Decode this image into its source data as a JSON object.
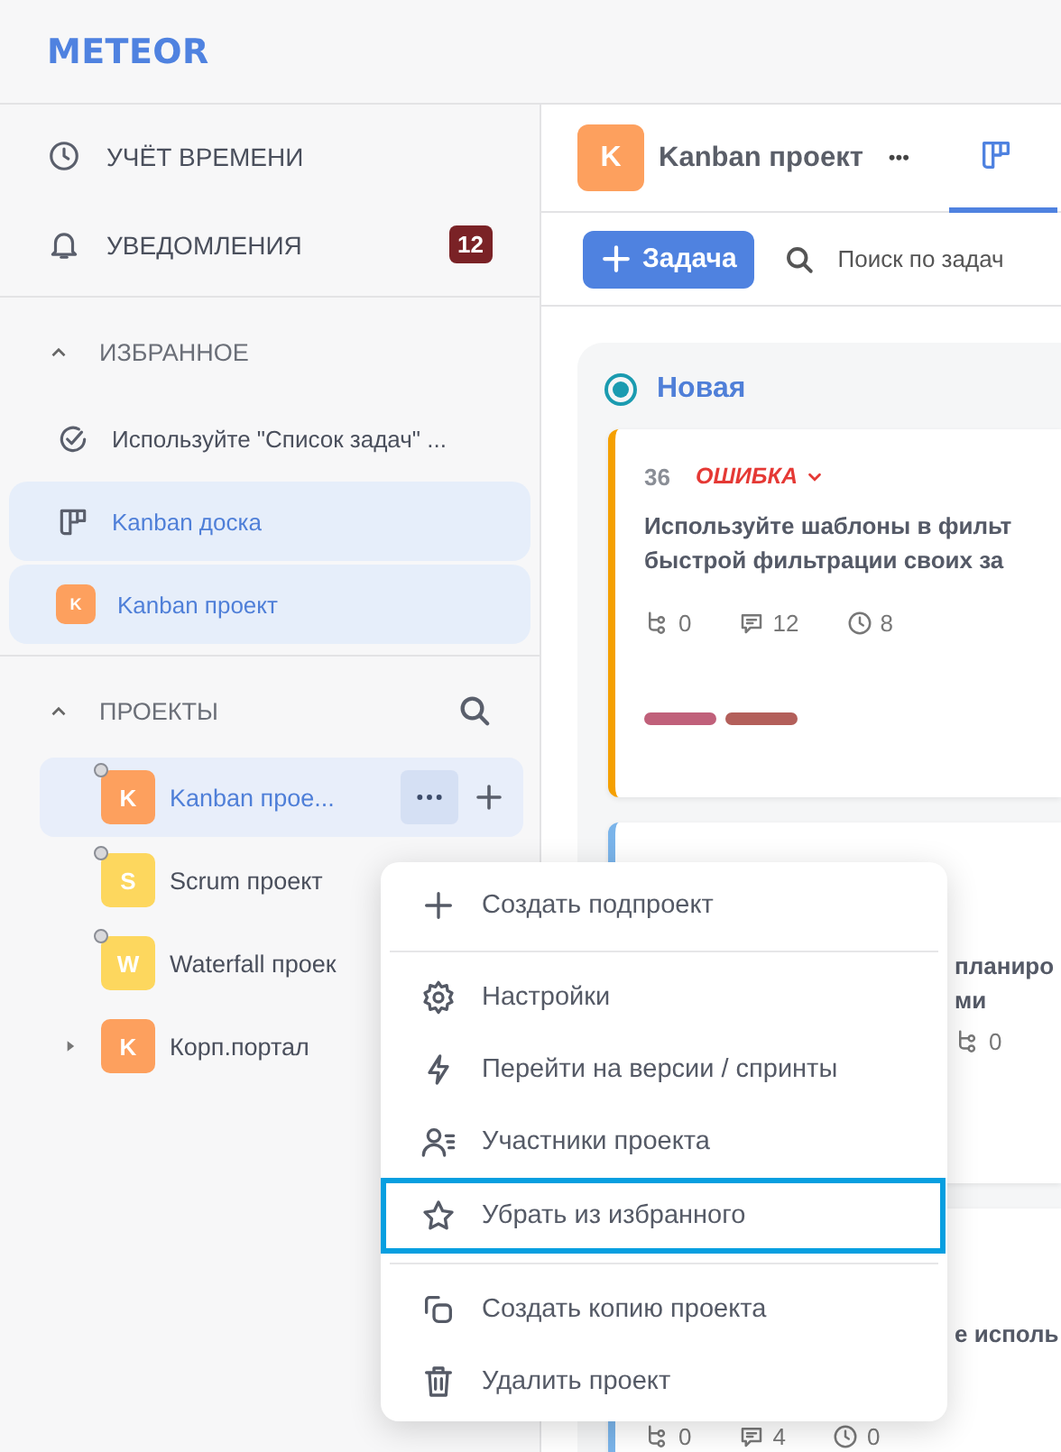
{
  "logo": "METEOR",
  "nav": [
    {
      "label": "УЧЁТ ВРЕМЕНИ"
    },
    {
      "label": "УВЕДОМЛЕНИЯ",
      "badge": "12"
    }
  ],
  "favorites": {
    "title": "ИЗБРАННОЕ",
    "expanded": true,
    "items": [
      {
        "kind": "task",
        "label": "Используйте \"Список задач\" ...",
        "selected": false
      },
      {
        "kind": "board",
        "label": "Kanban доска",
        "selected": true
      },
      {
        "kind": "project",
        "avatar": "K",
        "color": "#fda05e",
        "label": "Kanban проект",
        "selected": true
      }
    ]
  },
  "projects": {
    "title": "ПРОЕКТЫ",
    "expanded": true,
    "items": [
      {
        "avatar": "K",
        "color": "#fda05e",
        "label": "Kanban прое...",
        "selected": true,
        "dot": true,
        "expandable": false
      },
      {
        "avatar": "S",
        "color": "#fdd75e",
        "label": "Scrum проект",
        "selected": false,
        "dot": true,
        "expandable": false
      },
      {
        "avatar": "W",
        "color": "#fdd75e",
        "label": "Waterfall проек",
        "selected": false,
        "dot": true,
        "expandable": false
      },
      {
        "avatar": "K",
        "color": "#fda05e",
        "label": "Корп.портал",
        "selected": false,
        "dot": false,
        "expandable": true
      }
    ]
  },
  "header": {
    "avatar": "K",
    "color": "#fda05e",
    "title": "Kanban проект",
    "more": "•••"
  },
  "toolbar": {
    "button": "Задача",
    "search_placeholder": "Поиск по задач"
  },
  "column": {
    "title": "Новая",
    "cards": [
      {
        "number": "36",
        "type": "ОШИБКА",
        "color": "#f5a000",
        "title_lines": [
          "Используйте шаблоны в фильт",
          "быстрой фильтрации своих за"
        ],
        "stats": [
          "0",
          "12",
          "8"
        ],
        "tags": [
          {
            "color": "#c0607a"
          },
          {
            "color": "#b35f5a"
          }
        ]
      },
      {
        "color": "#7ab4ea",
        "title_lines": [
          "планиро",
          "ми"
        ],
        "stats": [
          "0"
        ]
      },
      {
        "color": "#7ab4ea",
        "title_lines": [
          "е исполь"
        ],
        "stats": [
          "0",
          "4",
          "0"
        ]
      }
    ]
  },
  "menu": {
    "groups": [
      [
        {
          "label": "Создать подпроект",
          "selected": false
        }
      ],
      [
        {
          "label": "Настройки",
          "selected": false
        },
        {
          "label": "Перейти на версии / спринты",
          "selected": false
        },
        {
          "label": "Участники проекта",
          "selected": false
        },
        {
          "label": "Убрать из избранного",
          "selected": true
        }
      ],
      [
        {
          "label": "Создать копию проекта",
          "selected": false
        },
        {
          "label": "Удалить проект",
          "selected": false
        }
      ]
    ]
  }
}
